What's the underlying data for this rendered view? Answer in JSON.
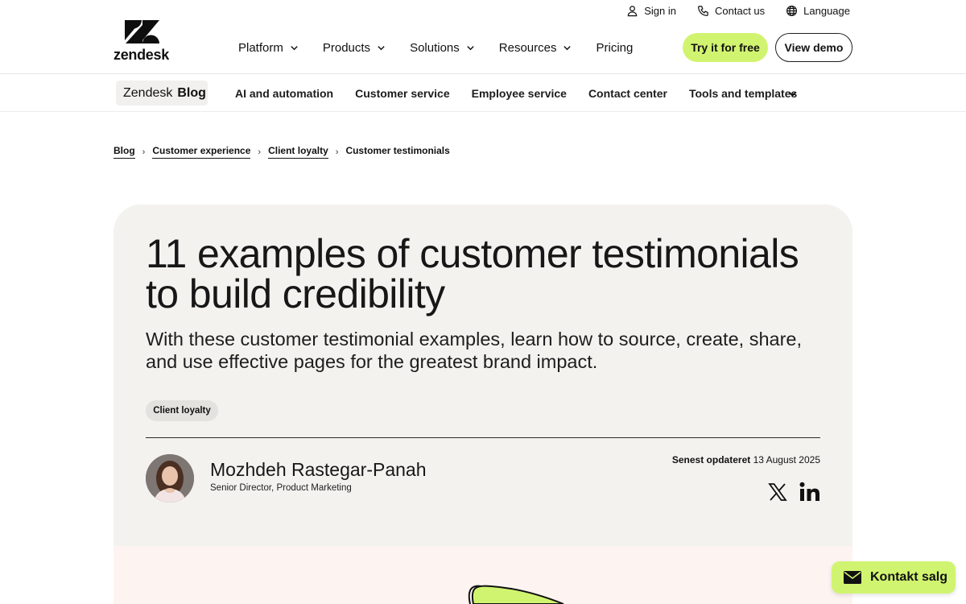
{
  "utility_bar": {
    "sign_in": "Sign in",
    "contact_us": "Contact us",
    "language": "Language"
  },
  "logo": {
    "wordmark": "zendesk"
  },
  "main_nav": {
    "items": [
      "Platform",
      "Products",
      "Solutions",
      "Resources"
    ],
    "pricing": "Pricing",
    "try_free": "Try it for free",
    "view_demo": "View demo"
  },
  "blog_nav": {
    "brand_part1": "Zendesk",
    "brand_part2": "Blog",
    "items": [
      "AI and automation",
      "Customer service",
      "Employee service",
      "Contact center",
      "Tools and templates"
    ]
  },
  "breadcrumb": {
    "items": [
      "Blog",
      "Customer experience",
      "Client loyalty"
    ],
    "current": "Customer testimonials"
  },
  "article": {
    "title": "11 examples of customer testimonials to build credibility",
    "subtitle": "With these customer testimonial examples, learn how to source, create, share, and use effective pages for the greatest brand impact.",
    "tag": "Client loyalty",
    "author_name": "Mozhdeh Rastegar-Panah",
    "author_role": "Senior Director, Product Marketing",
    "updated_label": "Senest opdateret",
    "updated_date": "13 August 2025"
  },
  "floating": {
    "kontakt_label": "Kontakt salg"
  },
  "colors": {
    "accent": "#d1f470",
    "card_bg": "#f3f2ef",
    "text": "#171717"
  }
}
